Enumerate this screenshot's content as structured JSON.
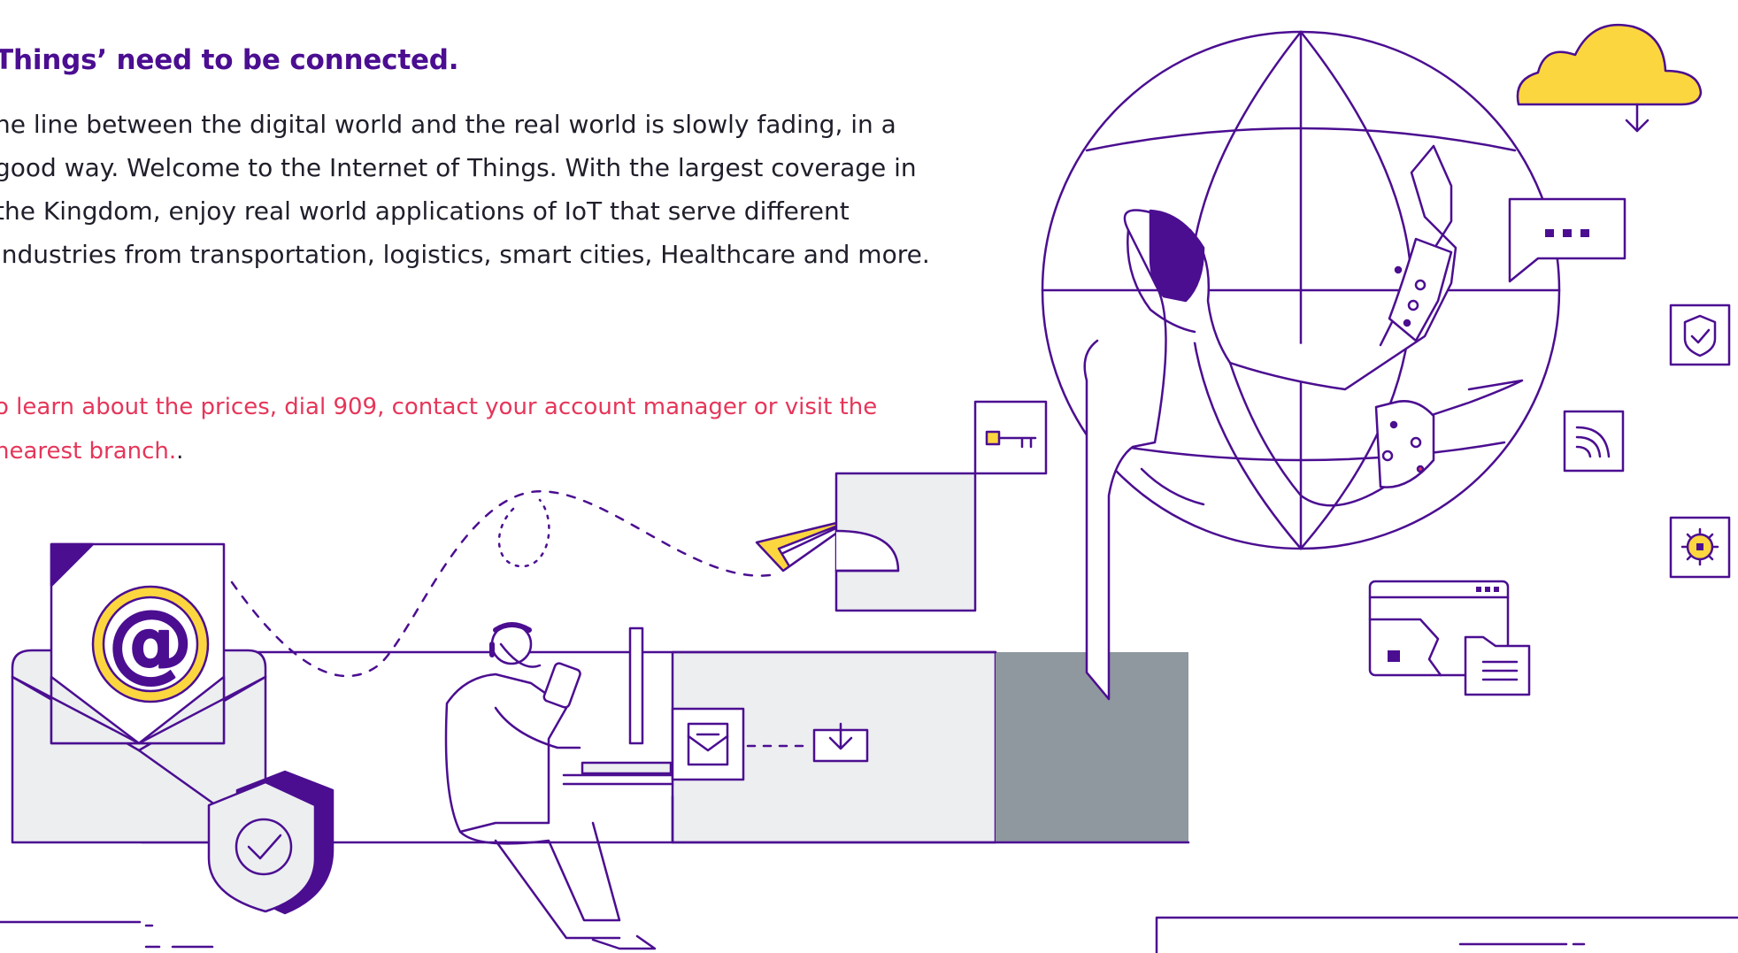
{
  "heading": "Things’ need to be connected.",
  "paragraph": "he line between the digital world and the real world is slowly fading, in a good way. Welcome to the Internet of Things. With the largest coverage in the Kingdom, enjoy real world applications of IoT that serve different industries from transportation, logistics, smart cities, Healthcare and more.",
  "note": "o learn about the prices, dial 909, contact your account manager or visit the nearest branch.",
  "note_trailing": ".",
  "illustration": {
    "email_symbol": "@",
    "icons": [
      "cloud-download-icon",
      "chat-bubble-icon",
      "shield-check-icon",
      "wifi-signal-icon",
      "gear-icon",
      "key-icon",
      "paper-plane-icon",
      "envelope-icon",
      "download-icon",
      "browser-window-icon",
      "document-icon",
      "headset-icon",
      "phone-icon"
    ]
  },
  "colors": {
    "brand_purple": "#4b0e91",
    "accent_red": "#e5365a",
    "accent_yellow": "#fcd63f",
    "light_gray": "#eceef0",
    "dark_gray": "#8e989e"
  }
}
